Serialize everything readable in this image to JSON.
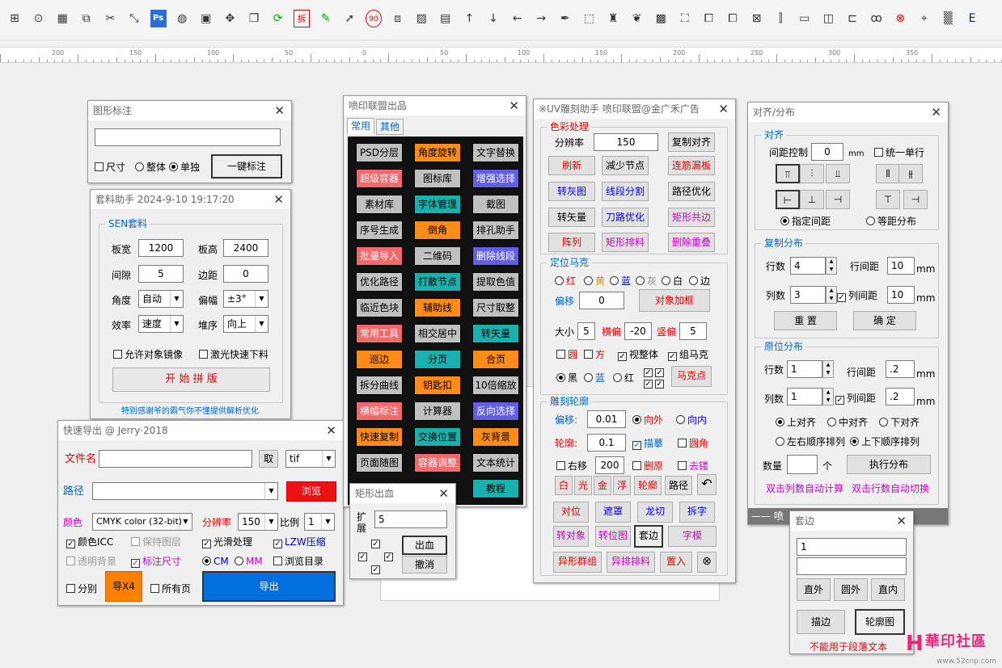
{
  "toolbar": {
    "icons": [
      "duplicate-icon",
      "more-icon",
      "barcode-icon",
      "copy-icon",
      "cut-icon",
      "resize-icon",
      "ps-icon",
      "color-wheel-icon",
      "badge-icon",
      "crosshair-icon",
      "layers-icon",
      "refresh-icon",
      "split-icon",
      "pen-icon",
      "cursor-icon",
      "rotate-icon",
      "shapes-icon",
      "image-icon",
      "save-icon",
      "arrow-up-icon",
      "arrow-down-icon",
      "arrow-left-icon",
      "arrow-right-icon",
      "pen-tool-icon",
      "dashed-box-icon",
      "character-icon",
      "balloon-icon",
      "grid-icon",
      "select-icon",
      "frame-icon",
      "frame2-icon",
      "align-icon",
      "distribute-icon",
      "monitor-icon",
      "align-center-icon",
      "valign-icon",
      "text-icon",
      "close-icon",
      "target-icon",
      "code-icon",
      "e-icon"
    ],
    "ps_label": "Ps",
    "split_label": "拆",
    "rotate_label": "90"
  },
  "ruler": {
    "ticks": [
      "200",
      "150",
      "100",
      "50",
      "0",
      "50",
      "100",
      "150",
      "200",
      "250",
      "300",
      "350"
    ]
  },
  "w1": {
    "title": "图形标注",
    "cb_size": "尺寸",
    "r_whole": "整体",
    "r_single": "单独",
    "btn": "一键标注"
  },
  "w2": {
    "title": "套料助手 2024-9-10 19:17:20",
    "group": "SEN套料",
    "board_w_l": "板宽",
    "board_w": "1200",
    "board_h_l": "板高",
    "board_h": "2400",
    "gap_l": "间隙",
    "gap": "5",
    "margin_l": "边距",
    "margin": "0",
    "angle_l": "角度",
    "angle": "自动",
    "offset_l": "偏幅",
    "offset": "±3°",
    "eff_l": "效率",
    "eff": "速度",
    "stack_l": "堆序",
    "stack": "向上",
    "cb_mirror": "允许对象镜像",
    "cb_laser": "激光快速下料",
    "start": "开 始 拼 版",
    "footer": "特别感谢爷的霸气你不懂提供解析优化"
  },
  "w3": {
    "title": "快速导出 @ Jerry·2018",
    "file_l": "文件名",
    "take": "取",
    "ext": "tif",
    "path_l": "路径",
    "browse": "浏览",
    "color_l": "颜色",
    "color": "CMYK color (32-bit)",
    "res_l": "分辨率",
    "res": "150",
    "ratio_l": "比例",
    "ratio": "1",
    "cb_icc": "颜色ICC",
    "cb_layer": "保持图层",
    "cb_smooth": "光滑处理",
    "cb_lzw": "LZW压缩",
    "cb_trans": "透明背景",
    "cb_dim": "标注尺寸",
    "r_cm": "CM",
    "r_mm": "MM",
    "cb_dir": "浏览目录",
    "cb_sep": "分别",
    "x4": "导X4",
    "cb_all": "所有页",
    "export": "导出"
  },
  "w4": {
    "title": "喷印联盟出品",
    "tab1": "常用",
    "tab2": "其他",
    "buttons": [
      [
        "PSD分层",
        "角度旋转",
        "文字替换"
      ],
      [
        "超级容器",
        "图标库",
        "增强选择"
      ],
      [
        "素材库",
        "字体管理",
        "截图"
      ],
      [
        "序号生成",
        "倒角",
        "排孔助手"
      ],
      [
        "批量导入",
        "二维码",
        "删除线段"
      ],
      [
        "优化路径",
        "打散节点",
        "提取色值"
      ],
      [
        "临近色块",
        "辅助线",
        "尺寸取整"
      ],
      [
        "常用工具",
        "相交居中",
        "转矢量"
      ],
      [
        "巡边",
        "分页",
        "合页"
      ],
      [
        "拆分曲线",
        "钥匙扣",
        "10倍缩放"
      ],
      [
        "横幅标注",
        "计算器",
        "反向选择"
      ],
      [
        "快速复制",
        "交换位置",
        "灰背景"
      ],
      [
        "页面随图",
        "容器调整",
        "文本统计"
      ],
      [
        "",
        "",
        "教程"
      ]
    ]
  },
  "w5": {
    "title": "矩形出血",
    "ext_l": "扩展",
    "ext": "5",
    "ok": "出血",
    "cancel": "撤消"
  },
  "w6": {
    "title": "※UV雕刻助手 喷印联盟@金广禾广告",
    "g1": "色彩处理",
    "res_l": "分辨率",
    "res": "150",
    "copyalign": "复制对齐",
    "refresh": "刷新",
    "reduce": "减少节点",
    "fillgap": "连筋漏板",
    "gray": "转灰图",
    "segsplit": "线段分割",
    "pathopt": "路径优化",
    "vector": "转矢量",
    "knife": "刀路优化",
    "rectedge": "矩形共边",
    "array": "阵列",
    "rectsort": "矩形排料",
    "deldup": "删除重叠",
    "g2": "定位马克",
    "c_red": "红",
    "c_yellow": "黄",
    "c_blue": "蓝",
    "c_gray": "灰",
    "c_white": "白",
    "c_edge": "边",
    "shift_l": "偏移",
    "shift": "0",
    "addframe": "对象加框",
    "size_l": "大小",
    "size": "5",
    "hshift_l": "横偏",
    "hshift": "-20",
    "vshift_l": "竖偏",
    "vshift": "5",
    "cb_circle": "圆",
    "cb_square": "方",
    "cb_whole": "视整体",
    "cb_group": "组马克",
    "m_black": "黑",
    "m_blue": "蓝",
    "m_red": "红",
    "markpt": "马克点",
    "g3": "雕刻轮廓",
    "off_l": "偏移:",
    "off": "0.01",
    "out": "向外",
    "in": "向内",
    "cont_l": "轮廓:",
    "cont": "0.1",
    "cb_stroke": "描摹",
    "cb_round": "圆角",
    "cb_rshift": "右移",
    "rshift": "200",
    "cb_delorig": "删原",
    "cb_delbuild": "去镂",
    "b_white": "白",
    "b_light": "光",
    "b_gold": "金",
    "b_float": "浮",
    "b_contour": "轮廓",
    "b_path": "路径",
    "pos": "对位",
    "mask": "遮罩",
    "dragon": "龙切",
    "split": "拆字",
    "rotobj": "转对象",
    "rotpos": "转位图",
    "setedge": "套边",
    "font": "字模",
    "grp": "异形群组",
    "sortirr": "异排排料",
    "place": "置入"
  },
  "w7": {
    "title": "对齐/分布",
    "g1": "对齐",
    "spacing_l": "间距控制",
    "spacing": "0",
    "mm": "mm",
    "cb_row": "统一单行",
    "r_spec": "指定间距",
    "r_equal": "等距分布",
    "g2": "复制分布",
    "rows_l": "行数",
    "rows": "4",
    "rowgap_l": "行间距",
    "rowgap": "10",
    "cols_l": "列数",
    "cols": "3",
    "colgap_l": "列间距",
    "colgap": "10",
    "reset": "重 置",
    "confirm": "确 定",
    "g3": "原位分布",
    "rows2": "1",
    "rowgap2": ".2",
    "cols2": "1",
    "colgap2": ".2",
    "r_top": "上对齐",
    "r_mid": "中对齐",
    "r_bot": "下对齐",
    "r_lr": "左右顺序排列",
    "r_ud": "上下顺序排列",
    "count_l": "数量",
    "unit": "个",
    "exec": "执行分布",
    "dbl_col": "双击列数自动计算",
    "dbl_row": "双击行数自动切换",
    "sep": "——  喷"
  },
  "w8": {
    "title": "套边",
    "val": "1",
    "outer": "直外",
    "round": "圆外",
    "inner": "直内",
    "tie": "描边",
    "contour": "轮廓图",
    "note": "不能用于段落文本"
  },
  "watermark": {
    "text": "華印社區",
    "sub": "www.52cnp.com"
  }
}
